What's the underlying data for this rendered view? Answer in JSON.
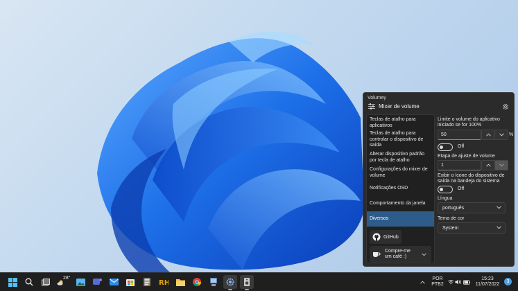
{
  "window": {
    "title": "Volumey",
    "header": "Mixer de volume"
  },
  "nav": {
    "items": [
      "Teclas de atalho para aplicativos",
      "Teclas de atalho para controlar o dispositivo de saída",
      "Alterar dispositivo padrão por tecla de atalho",
      "Configurações do mixer de volume",
      "Notificações OSD",
      "Comportamento da janela",
      "Diversos"
    ],
    "selected": "Diversos",
    "github_label": "GitHub",
    "coffee_label": "Compre-me um café :)"
  },
  "settings": {
    "limit_label": "Limite o volume do aplicativo iniciado se for 100%",
    "limit_value": "50",
    "limit_unit": "%",
    "limit_toggle": "Off",
    "step_label": "Etapa de ajuste de volume",
    "step_value": "1",
    "tray_label": "Exibir o ícone do dispositivo de saída na bandeja do sistema",
    "tray_toggle": "Off",
    "language_label": "Língua",
    "language_value": "português",
    "theme_label": "Tema de cor",
    "theme_value": "System"
  },
  "taskbar": {
    "weather_temp": "28°",
    "language_line1": "POR",
    "language_line2": "PTB2",
    "time": "15:23",
    "date": "11/07/2022",
    "notification_count": "3"
  },
  "colors": {
    "accent": "#2d5b8a",
    "window_bg": "#2b2b2b",
    "taskbar_bg": "#1f1f1f"
  }
}
